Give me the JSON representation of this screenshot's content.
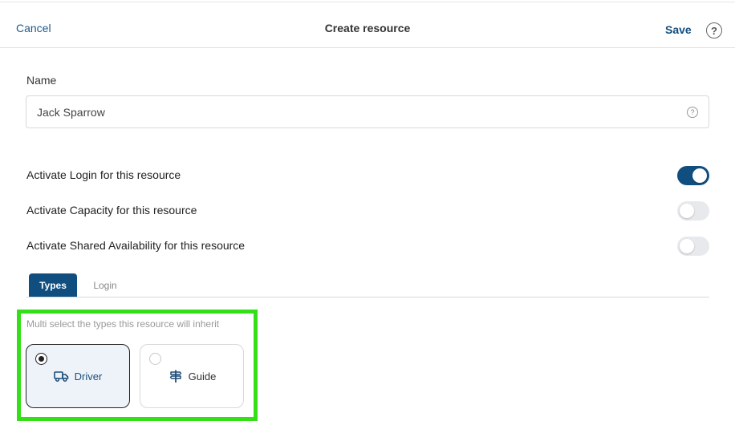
{
  "header": {
    "cancel_label": "Cancel",
    "title": "Create resource",
    "save_label": "Save",
    "help_glyph": "?"
  },
  "form": {
    "name_label": "Name",
    "name_value": "Jack Sparrow",
    "name_help_glyph": "?"
  },
  "toggles": [
    {
      "label": "Activate Login for this resource",
      "state": "on"
    },
    {
      "label": "Activate Capacity for this resource",
      "state": "off"
    },
    {
      "label": "Activate Shared Availability for this resource",
      "state": "off"
    }
  ],
  "tabs": [
    {
      "label": "Types",
      "active": true
    },
    {
      "label": "Login",
      "active": false
    }
  ],
  "types": {
    "hint": "Multi select the types this resource will inherit",
    "options": [
      {
        "label": "Driver",
        "icon": "truck-icon",
        "selected": true
      },
      {
        "label": "Guide",
        "icon": "signpost-icon",
        "selected": false
      }
    ]
  },
  "colors": {
    "brand": "#114e80",
    "highlight": "#33e017",
    "toggle_off": "#e8e9ec"
  }
}
